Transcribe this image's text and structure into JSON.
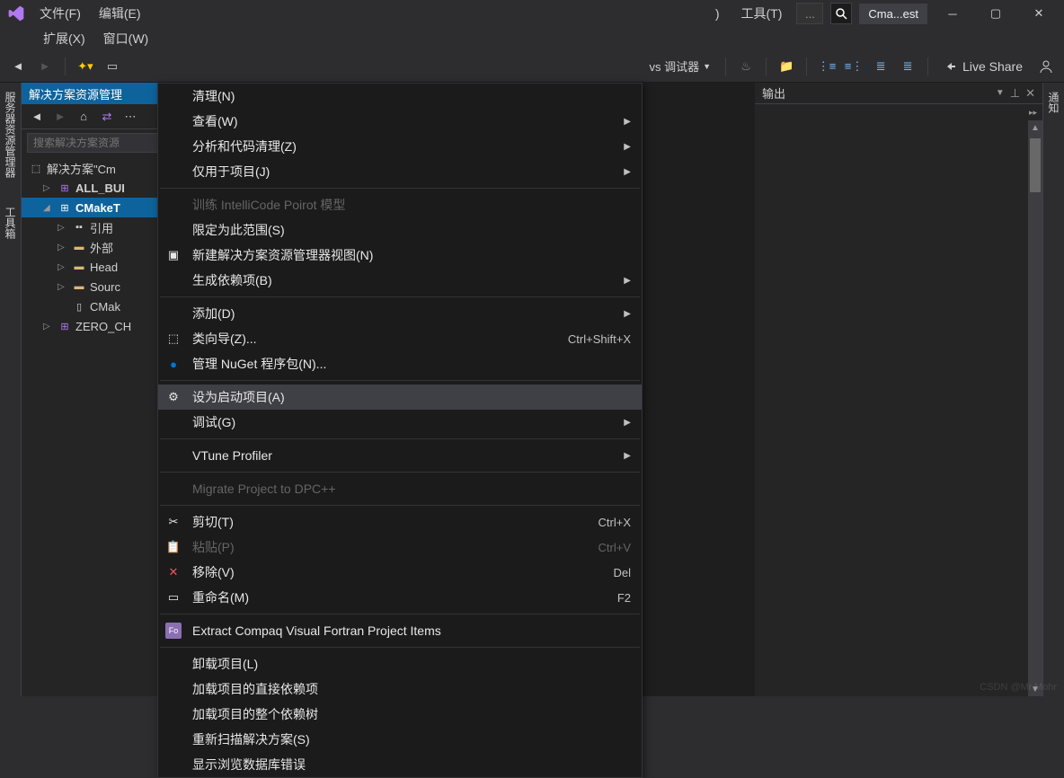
{
  "titlebar": {
    "menus_row1": [
      "文件(F)",
      "编辑(E)"
    ],
    "menus_row1_right": [
      "工具(T)"
    ],
    "menus_row2": [
      "扩展(X)",
      "窗口(W)"
    ],
    "search_ellipsis": "...",
    "title": "Cma...est",
    "partial_right": ")"
  },
  "toolbar": {
    "debugger": "vs 调试器",
    "live_share": "Live Share"
  },
  "sidebar_left": {
    "tab1": "服务器资源管理器",
    "tab2": "工具箱"
  },
  "sidebar_right": {
    "tab1": "通知"
  },
  "explorer": {
    "header": "解决方案资源管理",
    "search_placeholder": "搜索解决方案资源",
    "tree": {
      "solution": "解决方案\"Cm",
      "all_build": "ALL_BUI",
      "cmake_target": "CMakeT",
      "references": "引用",
      "external": "外部",
      "headers": "Head",
      "sources": "Sourc",
      "cmake_file": "CMak",
      "zero_check": "ZERO_CH"
    }
  },
  "output": {
    "title": "输出"
  },
  "context_menu": {
    "items": [
      {
        "label": "清理(N)"
      },
      {
        "label": "查看(W)",
        "submenu": true
      },
      {
        "label": "分析和代码清理(Z)",
        "submenu": true
      },
      {
        "label": "仅用于项目(J)",
        "submenu": true
      },
      {
        "sep": true
      },
      {
        "label": "训练 IntelliCode Poirot 模型",
        "disabled": true
      },
      {
        "label": "限定为此范围(S)"
      },
      {
        "label": "新建解决方案资源管理器视图(N)",
        "icon": "new-view"
      },
      {
        "label": "生成依赖项(B)",
        "submenu": true
      },
      {
        "sep": true
      },
      {
        "label": "添加(D)",
        "submenu": true
      },
      {
        "label": "类向导(Z)...",
        "icon": "wizard",
        "shortcut": "Ctrl+Shift+X"
      },
      {
        "label": "管理 NuGet 程序包(N)...",
        "icon": "nuget"
      },
      {
        "sep": true
      },
      {
        "label": "设为启动项目(A)",
        "icon": "gear",
        "highlighted": true
      },
      {
        "label": "调试(G)",
        "submenu": true
      },
      {
        "sep": true
      },
      {
        "label": "VTune Profiler",
        "submenu": true
      },
      {
        "sep": true
      },
      {
        "label": "Migrate Project to DPC++",
        "disabled": true
      },
      {
        "sep": true
      },
      {
        "label": "剪切(T)",
        "icon": "cut",
        "shortcut": "Ctrl+X"
      },
      {
        "label": "粘贴(P)",
        "icon": "paste",
        "shortcut": "Ctrl+V",
        "disabled": true
      },
      {
        "label": "移除(V)",
        "icon": "remove",
        "shortcut": "Del"
      },
      {
        "label": "重命名(M)",
        "icon": "rename",
        "shortcut": "F2"
      },
      {
        "sep": true
      },
      {
        "label": "Extract Compaq Visual Fortran Project Items",
        "icon": "fortran"
      },
      {
        "sep": true
      },
      {
        "label": "卸载项目(L)"
      },
      {
        "label": "加载项目的直接依赖项"
      },
      {
        "label": "加载项目的整个依赖树"
      },
      {
        "label": "重新扫描解决方案(S)"
      },
      {
        "label": "显示浏览数据库错误"
      }
    ]
  },
  "icons": {
    "cut": "✂",
    "remove": "✕",
    "gear": "⚙",
    "nuget": "●",
    "rename": "▭",
    "fortran": "Fo",
    "paste": "📋",
    "wizard": "⬚",
    "new-view": "▣"
  },
  "watermark": "CSDN @Mr.Mohr"
}
